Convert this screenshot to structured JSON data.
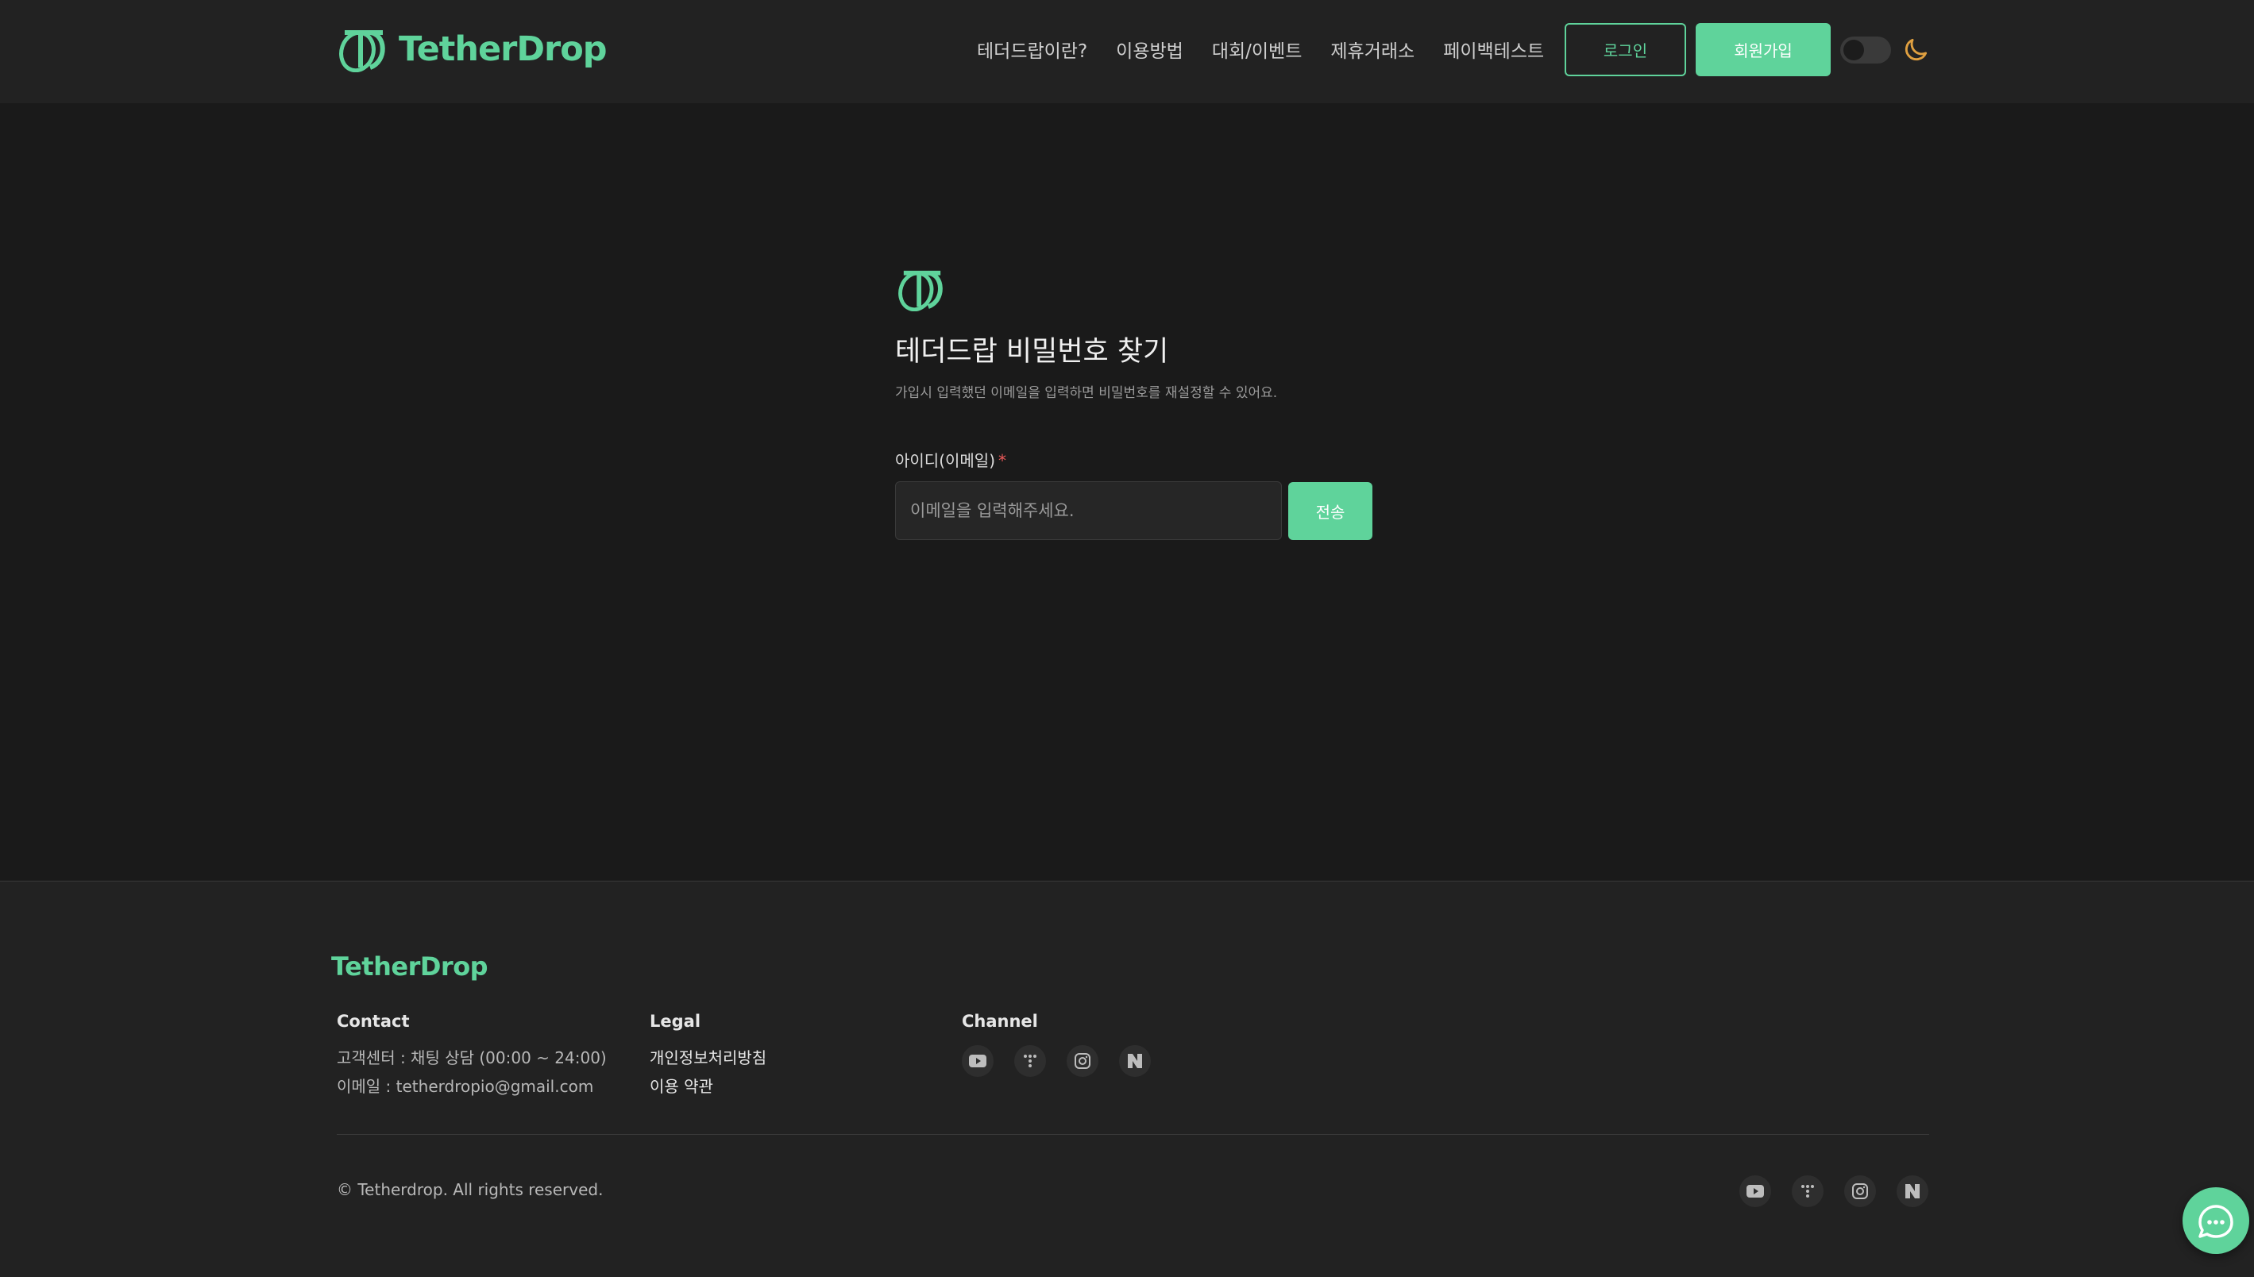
{
  "brand": {
    "name": "TetherDrop",
    "accent_color": "#5fd39b"
  },
  "nav": {
    "items": [
      "테더드랍이란?",
      "이용방법",
      "대회/이벤트",
      "제휴거래소",
      "페이백테스트"
    ],
    "login_label": "로그인",
    "signup_label": "회원가입",
    "theme_toggle": "dark-mode"
  },
  "main": {
    "title": "테더드랍 비밀번호 찾기",
    "subtitle": "가입시 입력했던 이메일을 입력하면 비밀번호를 재설정할 수 있어요.",
    "field_label": "아이디(이메일)",
    "required_mark": "*",
    "email_placeholder": "이메일을 입력해주세요.",
    "send_label": "전송"
  },
  "footer": {
    "brand": "TetherDrop",
    "contact": {
      "title": "Contact",
      "line1": "고객센터 : 채팅 상담 (00:00 ~ 24:00)",
      "line2": "이메일 : tetherdropio@gmail.com"
    },
    "legal": {
      "title": "Legal",
      "privacy": "개인정보처리방침",
      "terms": "이용 약관"
    },
    "channel": {
      "title": "Channel",
      "icons": [
        "youtube-icon",
        "dots-icon",
        "instagram-icon",
        "naver-icon"
      ]
    },
    "copyright": "© Tetherdrop. All rights reserved."
  }
}
